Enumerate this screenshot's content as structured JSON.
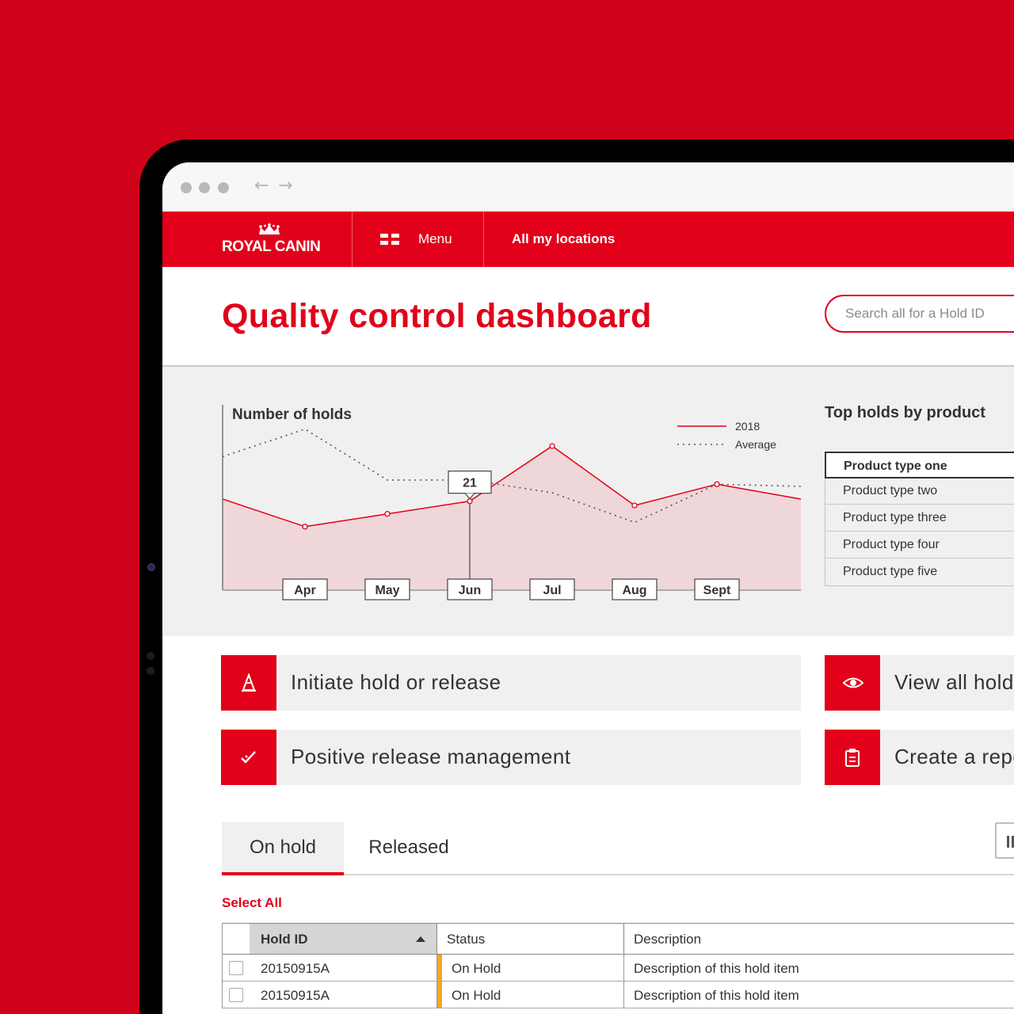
{
  "brand": {
    "name": "ROYAL CANIN"
  },
  "nav": {
    "menu_label": "Menu",
    "locations_label": "All my locations"
  },
  "page": {
    "title": "Quality control dashboard"
  },
  "search": {
    "placeholder": "Search all for a Hold ID"
  },
  "chart_data": {
    "type": "area",
    "title": "Number of holds",
    "xlabel": "",
    "ylabel": "",
    "categories": [
      "Apr",
      "May",
      "Jun",
      "Jul",
      "Aug",
      "Sept"
    ],
    "series": [
      {
        "name": "2018",
        "values": [
          15,
          18,
          21,
          34,
          20,
          25
        ]
      },
      {
        "name": "Average",
        "values": [
          38,
          26,
          26,
          23,
          16,
          25
        ]
      }
    ],
    "annotations": [
      {
        "category": "Jun",
        "series": "2018",
        "label": "21"
      }
    ],
    "legend": "top-right",
    "grid": false,
    "colors": {
      "2018": "#e2001a",
      "Average": "#555555",
      "fill": "#efd6d9"
    }
  },
  "top_holds": {
    "title": "Top holds by product",
    "items": [
      "Product type one",
      "Product type two",
      "Product type three",
      "Product type four",
      "Product type five"
    ],
    "selected_index": 0
  },
  "actions": [
    {
      "label": "Initiate hold or release",
      "icon": "cone-icon"
    },
    {
      "label": "View all hold",
      "icon": "eye-icon"
    },
    {
      "label": "Positive release management",
      "icon": "check-icon"
    },
    {
      "label": "Create a repo",
      "icon": "clipboard-icon"
    }
  ],
  "tabs": {
    "on_hold": "On hold",
    "released": "Released"
  },
  "select_all": "Select All",
  "table": {
    "headers": [
      "Hold ID",
      "Status",
      "Description"
    ],
    "rows": [
      {
        "id": "20150915A",
        "status": "On Hold",
        "description": "Description of this hold item"
      },
      {
        "id": "20150915A",
        "status": "On Hold",
        "description": "Description of this hold item"
      }
    ]
  },
  "colors": {
    "brand_red": "#e2001a",
    "background_red": "#d0021b",
    "status_on_hold": "#f5a623"
  }
}
